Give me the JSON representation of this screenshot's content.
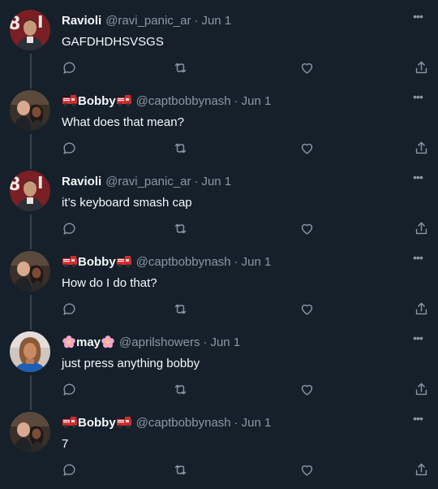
{
  "colors": {
    "background": "#15202b",
    "text": "#f7f9f9",
    "muted": "#8b98a5",
    "thread_line": "#38444d"
  },
  "icons": {
    "reply": "speech-bubble-icon",
    "retweet": "retweet-icon",
    "like": "heart-icon",
    "share": "share-icon",
    "more": "ellipsis-icon"
  },
  "tweets": [
    {
      "name": "Ravioli",
      "handle": "@ravi_panic_ar",
      "separator": "·",
      "date": "Jun 1",
      "text": "GAFDHDHSVSGS",
      "avatar": "ravioli",
      "name_emoji": "none"
    },
    {
      "name": "Bobby",
      "handle": "@captbobbynash",
      "separator": "·",
      "date": "Jun 1",
      "text": "What does that mean?",
      "avatar": "bobby",
      "name_emoji": "fire-engine"
    },
    {
      "name": "Ravioli",
      "handle": "@ravi_panic_ar",
      "separator": "·",
      "date": "Jun 1",
      "text": "it’s keyboard smash cap",
      "avatar": "ravioli",
      "name_emoji": "none"
    },
    {
      "name": "Bobby",
      "handle": "@captbobbynash",
      "separator": "·",
      "date": "Jun 1",
      "text": "How do I do that?",
      "avatar": "bobby",
      "name_emoji": "fire-engine"
    },
    {
      "name": "may",
      "handle": "@aprilshowers",
      "separator": "·",
      "date": "Jun 1",
      "text": "just press anything bobby",
      "avatar": "may",
      "name_emoji": "cherry-blossom"
    },
    {
      "name": "Bobby",
      "handle": "@captbobbynash",
      "separator": "·",
      "date": "Jun 1",
      "text": "7",
      "avatar": "bobby",
      "name_emoji": "fire-engine"
    }
  ]
}
